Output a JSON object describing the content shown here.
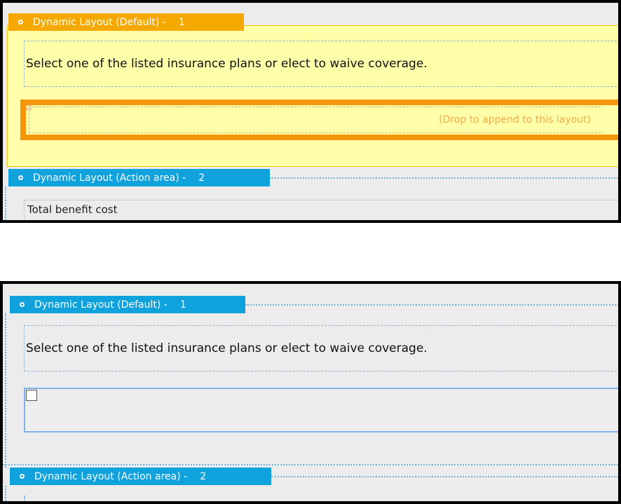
{
  "top_panel": {
    "default_layout_header": {
      "title": "Dynamic Layout (Default) -",
      "number": "1",
      "color": "#f5a800"
    },
    "instruction_text": "Select one of the listed insurance plans or elect to waive coverage.",
    "drop_hint": "(Drop to append to this layout)",
    "action_layout_header": {
      "title": "Dynamic Layout (Action area) -",
      "number": "2",
      "color": "#0fa2dd"
    },
    "benefit_label": "Total benefit cost"
  },
  "bottom_panel": {
    "default_layout_header": {
      "title": "Dynamic Layout (Default) -",
      "number": "1",
      "color": "#0fa2dd"
    },
    "instruction_text": "Select one of the listed insurance plans or elect to waive coverage.",
    "action_layout_header": {
      "title": "Dynamic Layout (Action area) -",
      "number": "2",
      "color": "#0fa2dd"
    }
  }
}
